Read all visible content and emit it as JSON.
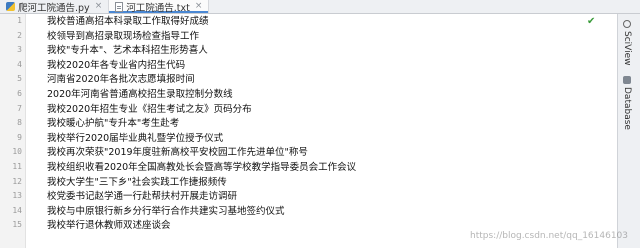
{
  "tabs": [
    {
      "label": "爬河工院通告.py",
      "active": false,
      "icon": "python-file-icon"
    },
    {
      "label": "河工院通告.txt",
      "active": true,
      "icon": "text-file-icon"
    }
  ],
  "tab_close_glyph": "×",
  "lines": [
    {
      "no": "1",
      "text": "我校普通高招本科录取工作取得好成绩"
    },
    {
      "no": "2",
      "text": "校领导到高招录取现场检查指导工作"
    },
    {
      "no": "3",
      "text": "我校\"专升本\"、艺术本科招生形势喜人"
    },
    {
      "no": "4",
      "text": "我校2020年各专业省内招生代码"
    },
    {
      "no": "5",
      "text": "河南省2020年各批次志愿填报时间"
    },
    {
      "no": "6",
      "text": "2020年河南省普通高校招生录取控制分数线"
    },
    {
      "no": "7",
      "text": "我校2020年招生专业《招生考试之友》页码分布"
    },
    {
      "no": "8",
      "text": "我校暖心护航\"专升本\"考生赴考"
    },
    {
      "no": "9",
      "text": "我校举行2020届毕业典礼暨学位授予仪式"
    },
    {
      "no": "10",
      "text": "我校再次荣获\"2019年度驻新高校平安校园工作先进单位\"称号"
    },
    {
      "no": "11",
      "text": "我校组织收看2020年全国高教处长会暨高等学校教学指导委员会工作会议"
    },
    {
      "no": "12",
      "text": "我校大学生\"三下乡\"社会实践工作捷报频传"
    },
    {
      "no": "13",
      "text": "校党委书记赵学通一行赴帮扶村开展走访调研"
    },
    {
      "no": "14",
      "text": "我校与中原银行新乡分行举行合作共建实习基地签约仪式"
    },
    {
      "no": "15",
      "text": "我校举行退休教师双述座谈会"
    }
  ],
  "status_icon": "check-icon",
  "status_glyph": "✔",
  "right_panel": [
    {
      "label": "SciView",
      "icon": "sciview-icon"
    },
    {
      "label": "Database",
      "icon": "database-icon"
    }
  ],
  "watermark": "https://blog.csdn.net/qq_16146103"
}
